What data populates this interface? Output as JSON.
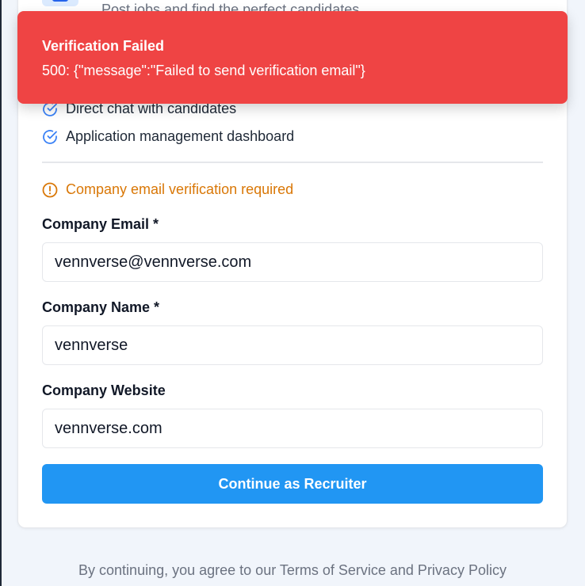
{
  "header": {
    "role_subtitle": "Post jobs and find the perfect candidates"
  },
  "features": [
    {
      "text": "Direct chat with candidates",
      "icon": "check-circle-icon"
    },
    {
      "text": "Application management dashboard",
      "icon": "check-circle-icon"
    }
  ],
  "warning": {
    "text": "Company email verification required",
    "icon": "alert-circle-icon",
    "color": "#d97706"
  },
  "form": {
    "email_label": "Company Email *",
    "email_value": "vennverse@vennverse.com",
    "name_label": "Company Name *",
    "name_value": "vennverse",
    "website_label": "Company Website",
    "website_value": "vennverse.com",
    "submit_label": "Continue as Recruiter"
  },
  "footer": {
    "text": "By continuing, you agree to our Terms of Service and Privacy Policy"
  },
  "toast": {
    "title": "Verification Failed",
    "message": "500: {\"message\":\"Failed to send verification email\"}",
    "color": "#ef4444"
  },
  "colors": {
    "accent": "#2196f3",
    "icon_blue": "#3b82f6"
  }
}
